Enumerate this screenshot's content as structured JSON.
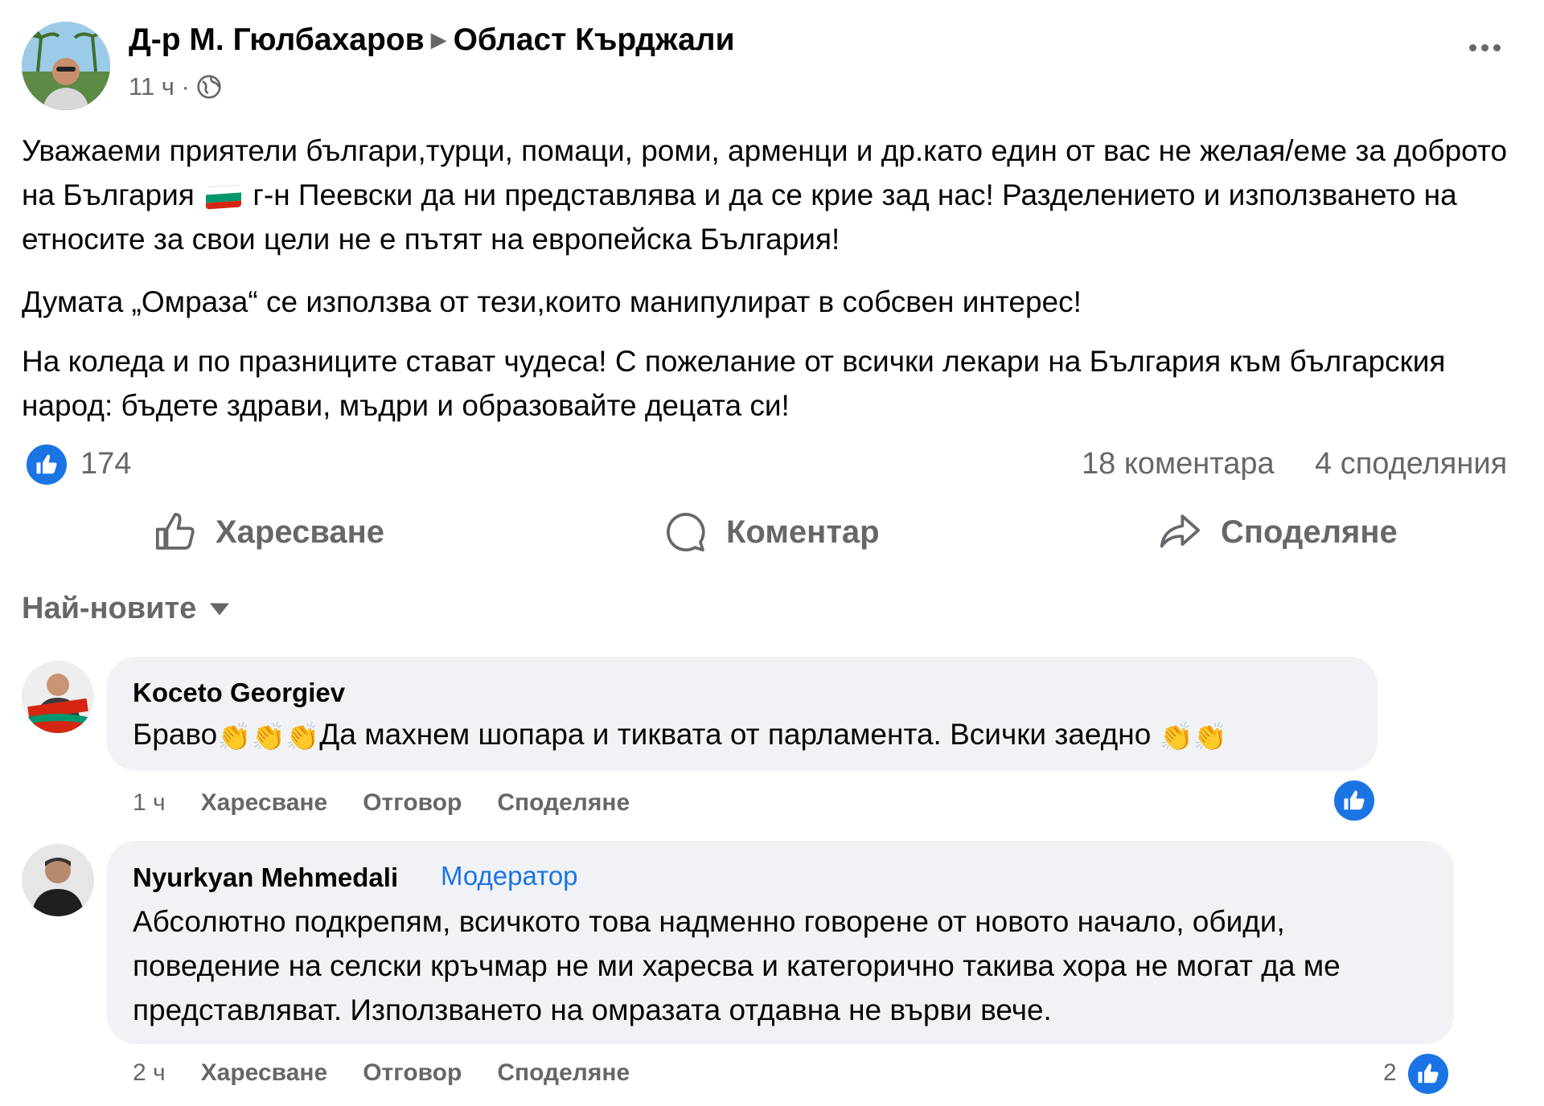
{
  "post": {
    "author": "Д-р М. Гюлбахаров",
    "group": "Област Кърджали",
    "time": "11 ч ·",
    "text_p1a": "Уважаеми приятели българи,турци, помаци, роми, арменци и др.като един от вас не желая/еме за доброто на България",
    "text_p1b": "г-н Пеевски да ни представлява и да се крие зад нас! Разделението и използването на етносите за свои цели не е пътят на европейска България!",
    "text_p2": "Думата „Омраза“ се използва от тези,които манипулират в собсвен интерес!",
    "text_p3": "На коледа и по празниците стават чудеса! С пожелание от всички лекари на България към българския народ: бъдете здрави, мъдри и образовайте децата си!",
    "likes": "174",
    "comments": "18 коментара",
    "shares": "4 споделяния"
  },
  "actions": {
    "like": "Харесване",
    "comment": "Коментар",
    "share": "Споделяне"
  },
  "sort_label": "Най-новите",
  "comments": [
    {
      "name": "Koceto Georgiev",
      "text_a": "Браво",
      "text_b": "Да махнем шопара и тиквата от парламента. Всички заедно",
      "time": "1 ч",
      "like": "Харесване",
      "reply": "Отговор",
      "share": "Споделяне"
    },
    {
      "name": "Nyurkyan Mehmedali",
      "badge": "Модератор",
      "text": "Абсолютно подкрепям, всичкото това надменно говорене от новото начало, обиди, поведение на селски кръчмар не ми харесва и категорично такива хора не могат да ме представляват. Използването на омразата отдавна не върви вече.",
      "time": "2 ч",
      "like": "Харесване",
      "reply": "Отговор",
      "share": "Споделяне",
      "reactions": "2"
    }
  ],
  "colors": {
    "accent": "#1b74e4",
    "secondary_text": "#65676b",
    "bubble": "#f0f2f5"
  },
  "icons": [
    "more-icon",
    "globe-icon",
    "like-icon",
    "comment-icon",
    "share-icon",
    "chevron-down-icon",
    "clap-icon",
    "flag-bg-icon"
  ]
}
